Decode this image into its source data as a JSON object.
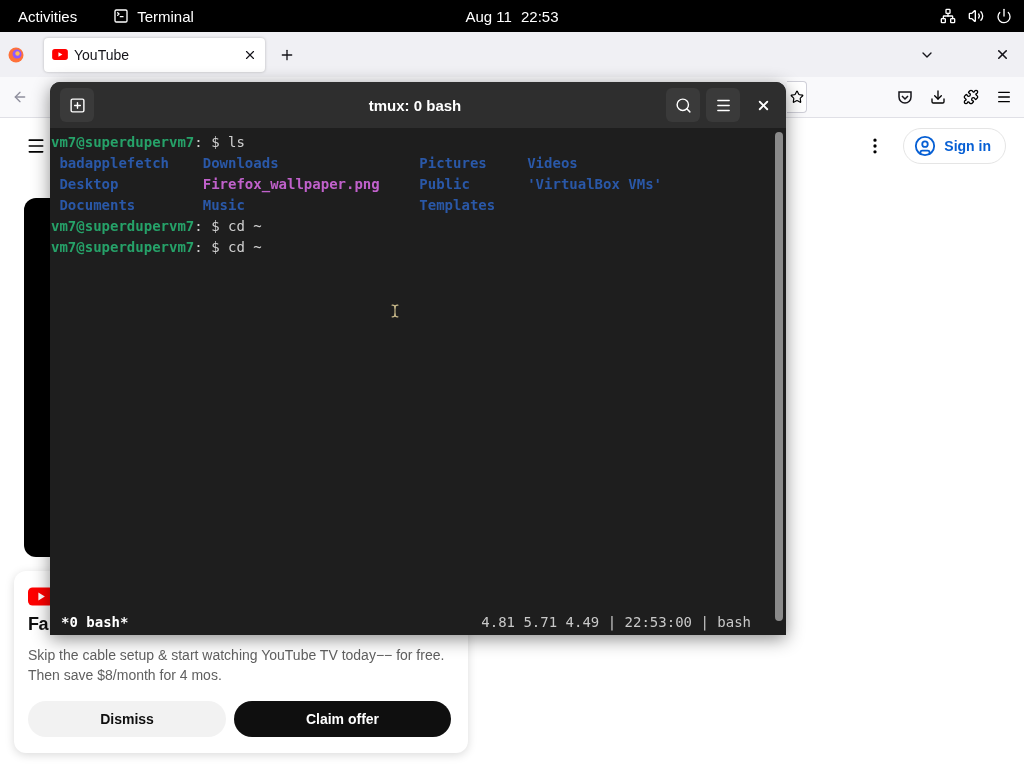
{
  "top_bar": {
    "activities": "Activities",
    "app_name": "Terminal",
    "date": "Aug 11",
    "time": "22:53"
  },
  "browser": {
    "tabs": [
      {
        "label": "YouTube",
        "selected": true
      }
    ],
    "page": {
      "sign_in": "Sign in",
      "promo": {
        "heading": "Fa",
        "text": "Skip the cable setup & start watching YouTube TV today−− for free. Then save $8/month for 4 mos.",
        "buttons": [
          {
            "label": "Dismiss",
            "kind": "secondary"
          },
          {
            "label": "Claim offer",
            "kind": "primary"
          }
        ]
      }
    }
  },
  "terminal": {
    "title": "tmux: 0 bash",
    "lines": [
      {
        "kind": "prompt",
        "user_host": "vm7@superdupervm7",
        "separator": ":",
        "symbol": "$",
        "command": "ls"
      },
      {
        "kind": "listing",
        "entries": [
          {
            "name": "badapplefetch",
            "kind": "directory"
          },
          {
            "name": "Downloads",
            "kind": "directory"
          },
          {
            "name": "Pictures",
            "kind": "directory"
          },
          {
            "name": "Videos",
            "kind": "directory"
          }
        ]
      },
      {
        "kind": "listing",
        "entries": [
          {
            "name": "Desktop",
            "kind": "directory"
          },
          {
            "name": "Firefox_wallpaper.png",
            "kind": "image"
          },
          {
            "name": "Public",
            "kind": "directory"
          },
          {
            "name": "'VirtualBox VMs'",
            "kind": "directory"
          }
        ]
      },
      {
        "kind": "listing",
        "entries": [
          {
            "name": "Documents",
            "kind": "directory"
          },
          {
            "name": "Music",
            "kind": "directory"
          },
          {
            "name": "Templates",
            "kind": "directory"
          }
        ]
      },
      {
        "kind": "prompt",
        "user_host": "vm7@superdupervm7",
        "separator": ":",
        "symbol": "$",
        "command": "cd ~"
      },
      {
        "kind": "prompt",
        "user_host": "vm7@superdupervm7",
        "separator": ":",
        "symbol": "$",
        "command": "cd ~"
      }
    ],
    "status": {
      "left": "*0 bash*",
      "right": "4.81 5.71 4.49 | 22:53:00 | bash"
    }
  }
}
